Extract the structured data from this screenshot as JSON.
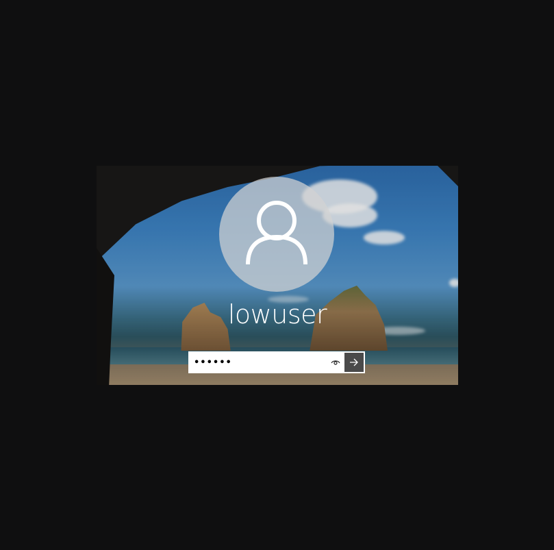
{
  "lock_screen": {
    "username": "lowuser",
    "password_value": "••••••",
    "icons": {
      "avatar": "user-icon",
      "reveal": "eye-icon",
      "submit": "arrow-right-icon"
    },
    "colors": {
      "background": "#0f0f10",
      "submit_button": "#4a4a4a",
      "text": "#ffffff"
    }
  }
}
